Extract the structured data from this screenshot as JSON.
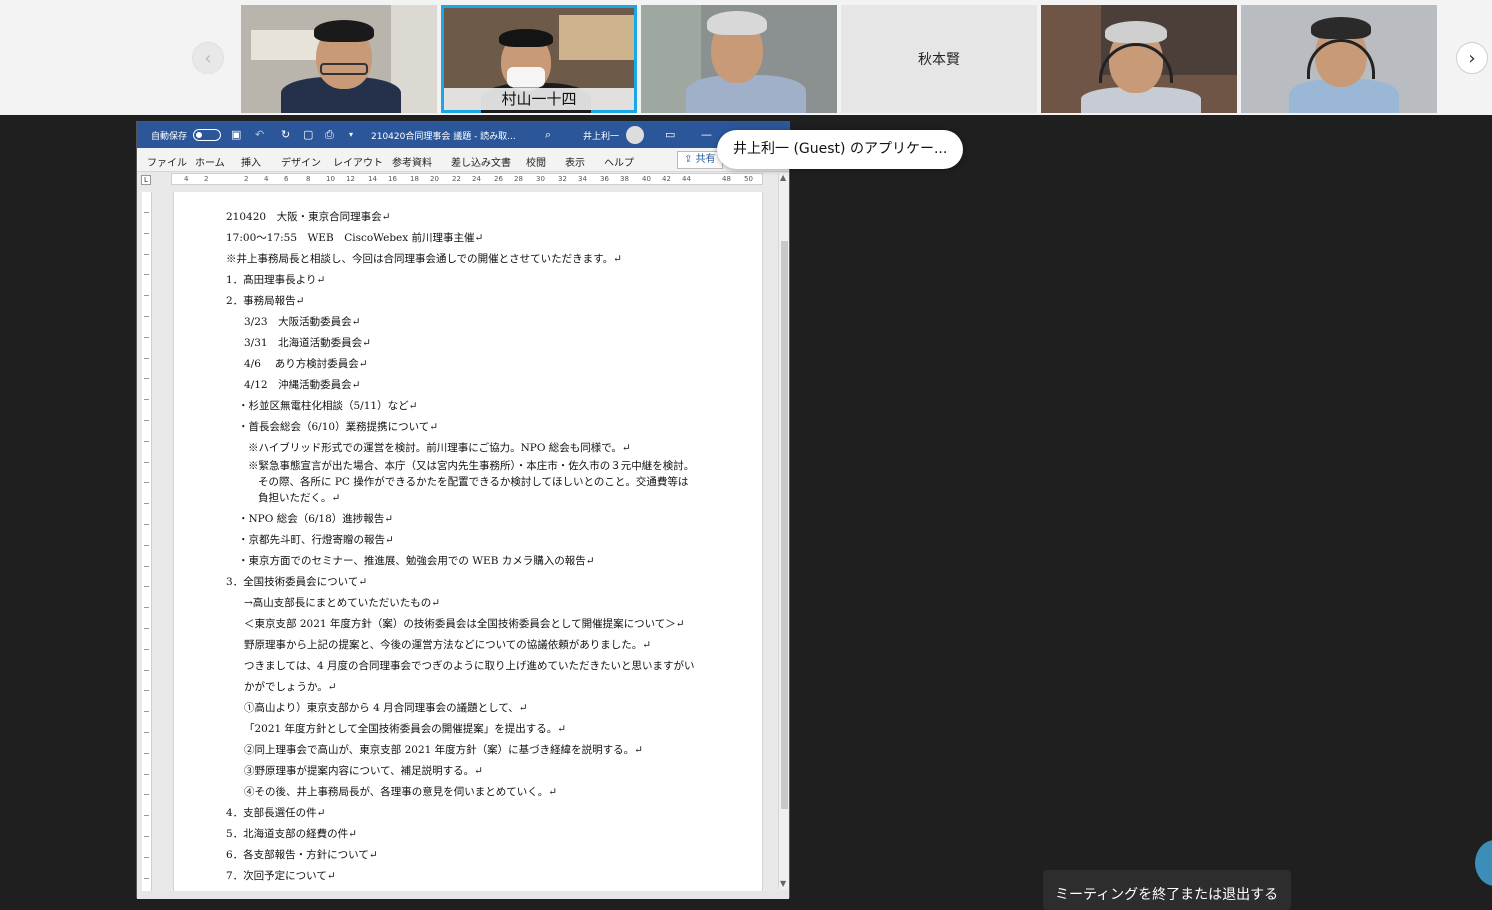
{
  "participants": {
    "tiles": [
      {
        "name": ""
      },
      {
        "name": "村山一十四",
        "active": true
      },
      {
        "name": ""
      },
      {
        "name": "秋本賢",
        "video": false
      },
      {
        "name": ""
      },
      {
        "name": ""
      }
    ],
    "prev_icon": "‹",
    "next_icon": "›"
  },
  "word": {
    "autosave_label": "自動保存",
    "autosave_state": "オフ",
    "doc_title": "210420合同理事会 議題 - 読み取...",
    "user_name": "井上利一",
    "menu": [
      "ファイル",
      "ホーム",
      "挿入",
      "デザイン",
      "レイアウト",
      "参考資料",
      "差し込み文書",
      "校閲",
      "表示",
      "ヘルプ"
    ],
    "share_label": "共有",
    "ruler_ticks": [
      "4",
      "2",
      "2",
      "4",
      "6",
      "8",
      "10",
      "12",
      "14",
      "16",
      "18",
      "20",
      "22",
      "24",
      "26",
      "28",
      "30",
      "32",
      "34",
      "36",
      "38",
      "40",
      "42",
      "44",
      "48",
      "50"
    ],
    "lines": [
      "210420　大阪・東京合同理事会↵",
      "17:00～17:55　WEB　CiscoWebex 前川理事主催↵",
      "※井上事務局長と相談し、今回は合同理事会通しでの開催とさせていただきます。↵",
      "1．髙田理事長より↵",
      "2．事務局報告↵",
      "3/23　大阪活動委員会↵",
      "3/31　北海道活動委員会↵",
      "4/6　 あり方検討委員会↵",
      "4/12　沖縄活動委員会↵",
      "・杉並区無電柱化相談（5/11）など↵",
      "・首長会総会（6/10）業務提携について↵",
      "※ハイブリッド形式での運営を検討。前川理事にご協力。NPO 総会も同様で。↵",
      "※緊急事態宣言が出た場合、本庁（又は宮内先生事務所）・本庄市・佐久市の３元中継を検討。",
      "その際、各所に PC 操作ができるかたを配置できるか検討してほしいとのこと。交通費等は",
      "負担いただく。↵",
      "・NPO 総会（6/18）進捗報告↵",
      "・京都先斗町、行燈寄贈の報告↵",
      "・東京方面でのセミナー、推進展、勉強会用での WEB カメラ購入の報告↵",
      "3．全国技術委員会について↵",
      "→高山支部長にまとめていただいたもの↵",
      "＜東京支部 2021 年度方針（案）の技術委員会は全国技術委員会として開催提案について＞↵",
      "野原理事から上記の提案と、今後の運営方法などについての協議依頼がありました。↵",
      "つきましては、4 月度の合同理事会でつぎのように取り上げ進めていただきたいと思いますがい",
      "かがでしょうか。↵",
      "①高山より）東京支部から 4 月合同理事会の議題として、↵",
      "「2021 年度方針として全国技術委員会の開催提案」を提出する。↵",
      "②同上理事会で高山が、東京支部 2021 年度方針（案）に基づき経緯を説明する。↵",
      "③野原理事が提案内容について、補足説明する。↵",
      "④その後、井上事務局長が、各理事の意見を伺いまとめていく。↵",
      "4．支部長選任の件↵",
      "5．北海道支部の経費の件↵",
      "6．各支部報告・方針について↵",
      "7．次回予定について↵"
    ]
  },
  "tooltip": "井上利一 (Guest) のアプリケー...",
  "end_meeting": "ミーティングを終了または退出する",
  "colors": {
    "word_blue": "#2b579a",
    "active_border": "#19a7e6",
    "background": "#1f1f1f"
  }
}
